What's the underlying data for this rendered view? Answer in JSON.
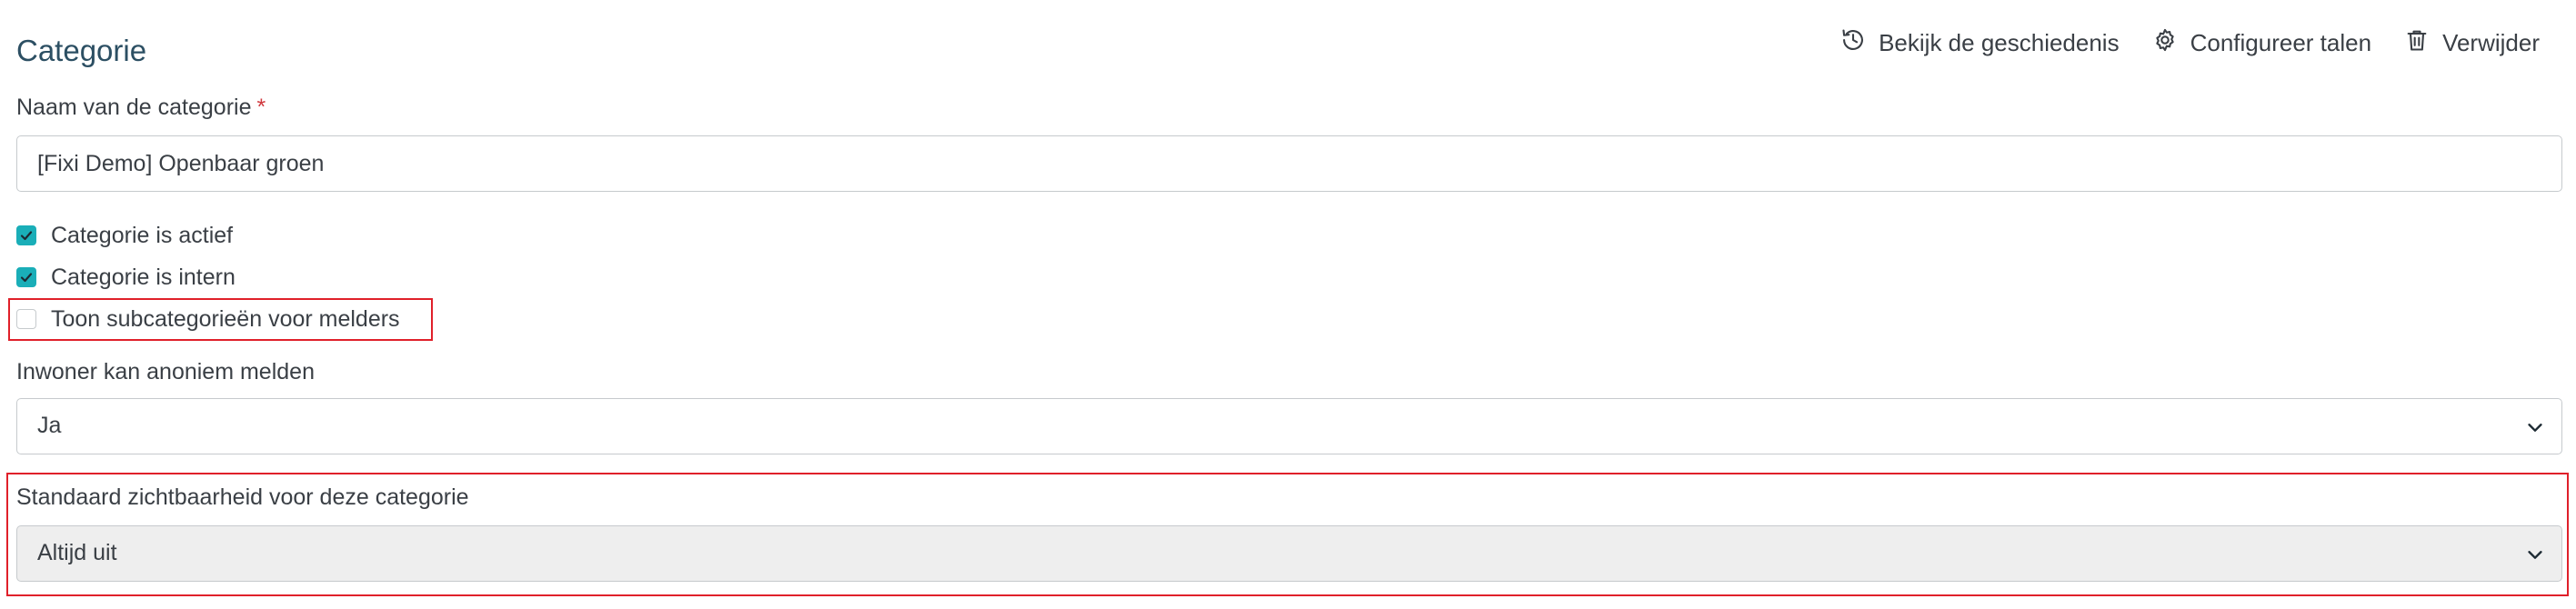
{
  "form": {
    "title": "Categorie",
    "actions": {
      "history": {
        "label": "Bekijk de geschiedenis",
        "icon": "history-icon"
      },
      "languages": {
        "label": "Configureer talen",
        "icon": "gear-icon"
      },
      "delete": {
        "label": "Verwijder",
        "icon": "trash-icon"
      }
    },
    "name_field": {
      "label": "Naam van de categorie",
      "required_marker": "*",
      "value": "[Fixi Demo] Openbaar groen"
    },
    "checkboxes": [
      {
        "label": "Categorie is actief",
        "checked": true
      },
      {
        "label": "Categorie is intern",
        "checked": true
      },
      {
        "label": "Toon subcategorieën voor melders",
        "checked": false
      }
    ],
    "anonymous_field": {
      "label": "Inwoner kan anoniem melden",
      "value": "Ja"
    },
    "visibility_field": {
      "label": "Standaard zichtbaarheid voor deze categorie",
      "value": "Altijd uit"
    }
  },
  "colors": {
    "accent": "#1aaeb8",
    "title": "#2c4f63",
    "highlight": "#e0202a",
    "required": "#d0393e"
  }
}
